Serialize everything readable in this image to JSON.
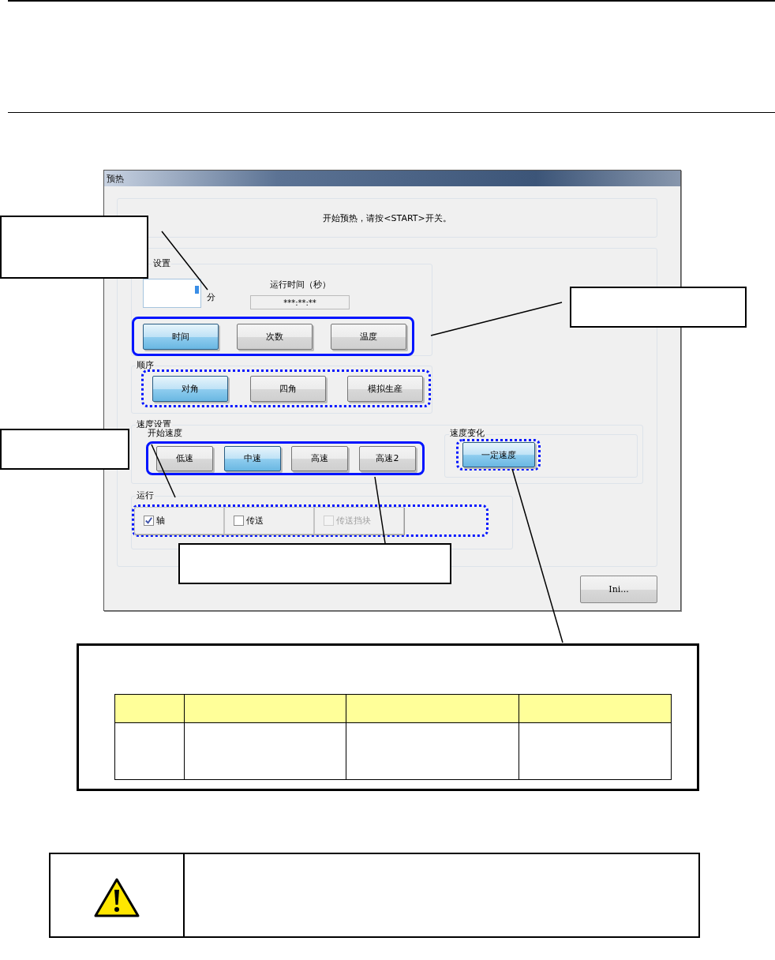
{
  "window": {
    "title": "预热"
  },
  "message": "开始预热，请按<START>开关。",
  "time_group": {
    "label": "设置",
    "unit": "分",
    "runtime_label": "运行时间（秒）",
    "runtime_value": "***:**:**",
    "highlight_dotted": false,
    "buttons": [
      {
        "label": "时间",
        "selected": true
      },
      {
        "label": "次数",
        "selected": false
      },
      {
        "label": "温度",
        "selected": false
      }
    ]
  },
  "order_group": {
    "label": "顺序",
    "highlight_dotted": true,
    "buttons": [
      {
        "label": "对角",
        "selected": true
      },
      {
        "label": "四角",
        "selected": false
      },
      {
        "label": "模拟生産",
        "selected": false
      }
    ]
  },
  "speed_group": {
    "label": "速度设置",
    "sublabel": "开始速度",
    "highlight_dotted": false,
    "buttons": [
      {
        "label": "低速",
        "selected": false
      },
      {
        "label": "中速",
        "selected": true
      },
      {
        "label": "高速",
        "selected": false
      },
      {
        "label": "高速2",
        "selected": false
      }
    ]
  },
  "speed_change": {
    "label": "速度变化",
    "highlight_dotted": true,
    "buttons": [
      {
        "label": "一定速度",
        "selected": true
      }
    ]
  },
  "run_group": {
    "label": "运行",
    "highlight_dotted": true,
    "checkboxes": [
      {
        "label": "轴",
        "checked": true,
        "disabled": false
      },
      {
        "label": "传送",
        "checked": false,
        "disabled": false
      },
      {
        "label": "传送挡块",
        "checked": false,
        "disabled": true
      }
    ]
  },
  "ini_button": "Ini..."
}
